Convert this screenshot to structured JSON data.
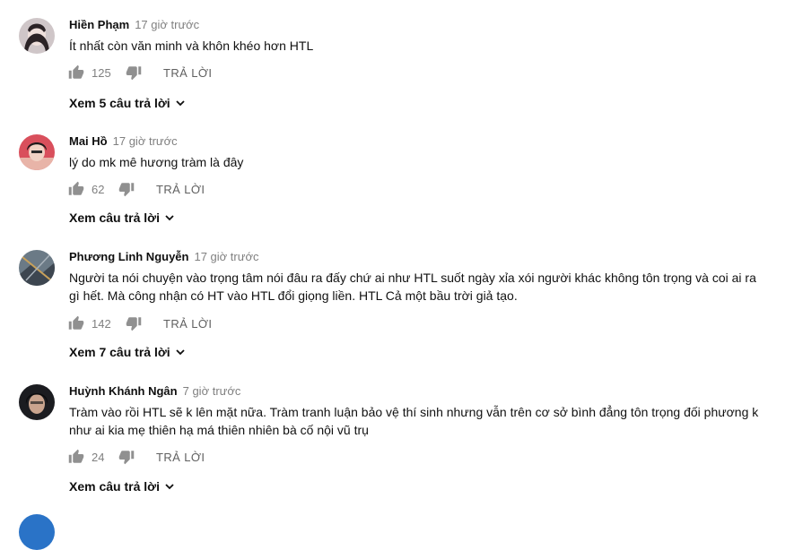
{
  "comments": [
    {
      "author": "Hiền Phạm",
      "time": "17 giờ trước",
      "text": "Ít nhất còn văn minh và khôn khéo hơn HTL",
      "likes": "125",
      "reply_label": "TRẢ LỜI",
      "view_replies": "Xem 5 câu trả lời"
    },
    {
      "author": "Mai Hồ",
      "time": "17 giờ trước",
      "text": "lý do mk mê hương tràm là đây",
      "likes": "62",
      "reply_label": "TRẢ LỜI",
      "view_replies": "Xem câu trả lời"
    },
    {
      "author": "Phương Linh Nguyễn",
      "time": "17 giờ trước",
      "text": "Người ta nói chuyện vào trọng tâm nói đâu ra đấy chứ ai như HTL suốt ngày xỉa xói người khác không tôn trọng và coi ai ra gì hết. Mà công nhận có HT vào HTL đổi giọng liền. HTL Cả một bầu trời giả tạo.",
      "likes": "142",
      "reply_label": "TRẢ LỜI",
      "view_replies": "Xem 7 câu trả lời"
    },
    {
      "author": "Huỳnh Khánh Ngân",
      "time": "7 giờ trước",
      "text": "Tràm vào rồi HTL sẽ k lên mặt nữa. Tràm tranh luận bảo vệ thí sinh nhưng vẫn trên cơ sở bình đẳng tôn trọng đối phương k như ai kia mẹ thiên hạ má thiên nhiên bà cố nội vũ trụ",
      "likes": "24",
      "reply_label": "TRẢ LỜI",
      "view_replies": "Xem câu trả lời"
    }
  ],
  "colors": {
    "meta": "#808080",
    "text": "#111111",
    "icon": "#909090"
  },
  "icons": {
    "like": "thumbs-up-icon",
    "dislike": "thumbs-down-icon",
    "expand": "chevron-down-icon"
  }
}
